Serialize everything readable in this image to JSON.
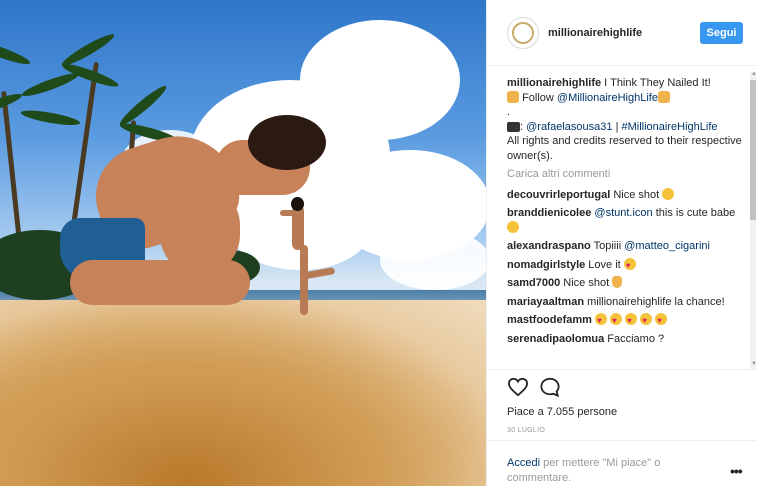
{
  "post": {
    "username": "millionairehighlife",
    "follow_label": "Segui",
    "caption_user": "millionairehighlife",
    "caption_text": " I Think They Nailed It!",
    "follow_line_prefix": "Follow ",
    "follow_line_handle": "@MillionaireHighLife",
    "dot_line": ".",
    "credit_handle": "@rafaelasousa31",
    "credit_sep": " | ",
    "credit_hashtag": "#MillionaireHighLife",
    "rights_text": "All rights and credits reserved to their respective owner(s).",
    "load_more": "Carica altri commenti",
    "likes_text": "Piace a 7.055 persone",
    "date": "30 LUGLIO",
    "login_link": "Accedi",
    "login_text": " per mettere \"Mi piace\" o commentare.",
    "more_options": "•••"
  },
  "comments": [
    {
      "user": "decouvrirleportugal",
      "text": " Nice shot ",
      "emoji": "smile"
    },
    {
      "user": "branddienicolee",
      "mention": " @stunt.icon",
      "text": " this is cute babe ",
      "emoji": "smile"
    },
    {
      "user": "alexandraspano",
      "text": " Topiiii ",
      "mention": "@matteo_cigarini"
    },
    {
      "user": "nomadgirlstyle",
      "text": " Love it ",
      "emoji": "heart-eyes"
    },
    {
      "user": "samd7000",
      "text": " Nice shot ",
      "emoji": "thumb"
    },
    {
      "user": "mariayaaltman",
      "text": " millionairehighlife la chance!"
    },
    {
      "user": "mastfoodefamm",
      "text": " ",
      "emoji": "heart-eyes x5"
    },
    {
      "user": "serenadipaolomua",
      "text": " Facciamo ?"
    }
  ],
  "icons": {
    "like": "heart-outline-icon",
    "comment": "comment-bubble-icon",
    "avatar": "millionaire-logo-avatar"
  },
  "colors": {
    "follow_button": "#3897f0",
    "link": "#003569",
    "muted": "#999999"
  }
}
